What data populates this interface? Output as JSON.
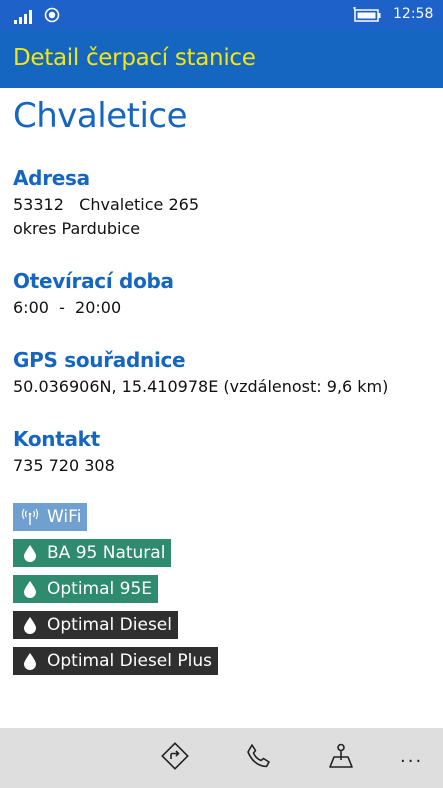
{
  "status_bar": {
    "signal_icon": "signal-bars-icon",
    "location_icon": "location-icon",
    "battery_icon": "battery-charging-icon",
    "time": "12:58"
  },
  "header": {
    "title": "Detail čerpací stanice",
    "background": "#1566c0",
    "title_color": "#f2e70e"
  },
  "station": {
    "name": "Chvaletice"
  },
  "address": {
    "title": "Adresa",
    "line1": "53312   Chvaletice 265",
    "line2": "okres Pardubice"
  },
  "opening_hours": {
    "title": "Otevírací doba",
    "value": "6:00  -  20:00"
  },
  "gps": {
    "title": "GPS souřadnice",
    "value": "50.036906N, 15.410978E (vzdálenost: 9,6 km)"
  },
  "contact": {
    "title": "Kontakt",
    "phone": "735 720 308"
  },
  "tags": [
    {
      "label": "WiFi",
      "icon": "wifi-antenna-icon",
      "color": "#6fa0cf"
    },
    {
      "label": "BA 95 Natural",
      "icon": "fuel-drop-icon",
      "color": "#2e8b6e"
    },
    {
      "label": "Optimal 95E",
      "icon": "fuel-drop-icon",
      "color": "#2e8b6e"
    },
    {
      "label": "Optimal Diesel",
      "icon": "fuel-drop-icon",
      "color": "#2f2f2f"
    },
    {
      "label": "Optimal Diesel Plus",
      "icon": "fuel-drop-icon",
      "color": "#2f2f2f"
    }
  ],
  "app_bar": {
    "buttons": [
      {
        "icon": "directions-icon"
      },
      {
        "icon": "phone-icon"
      },
      {
        "icon": "map-pin-icon"
      }
    ],
    "more": "..."
  }
}
